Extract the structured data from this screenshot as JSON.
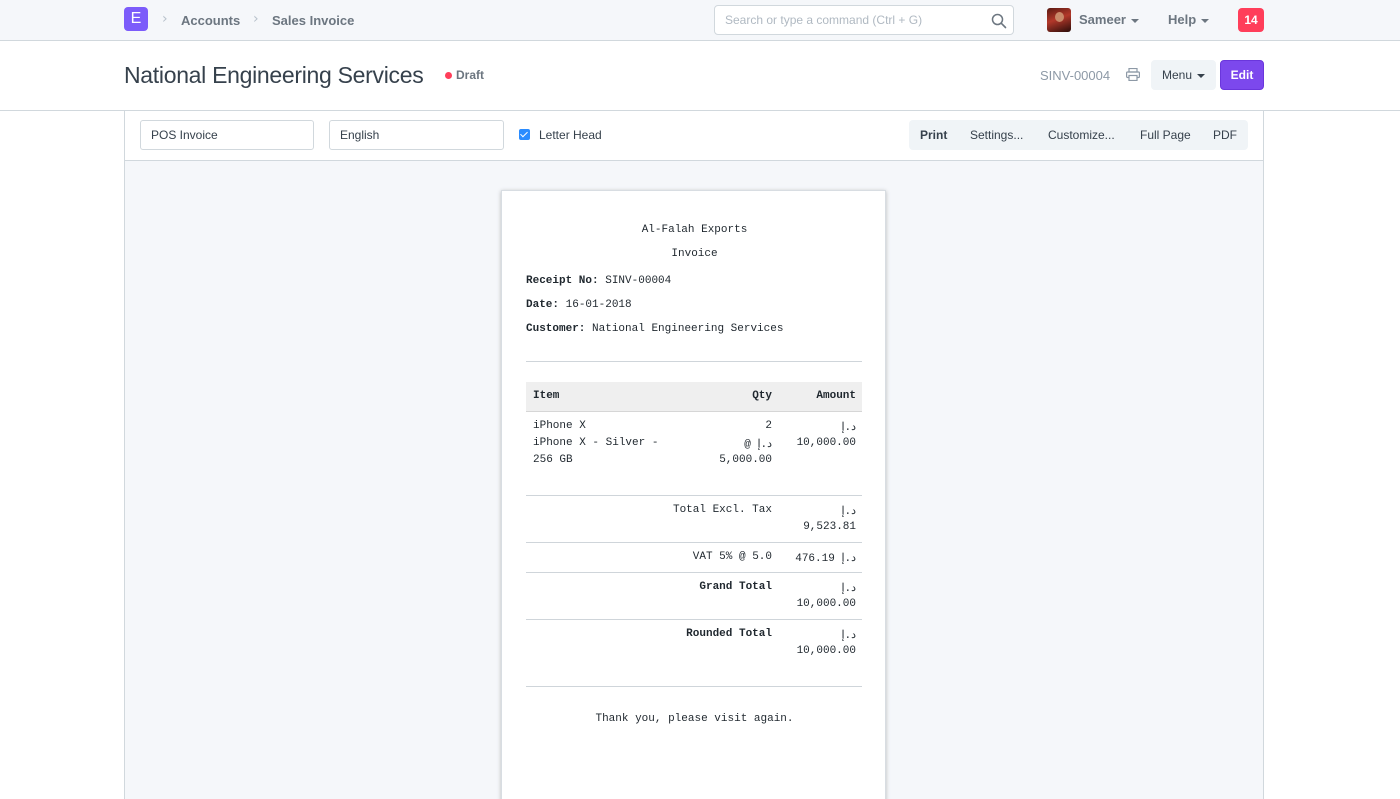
{
  "navbar": {
    "logo_letter": "E",
    "breadcrumbs": [
      "Accounts",
      "Sales Invoice"
    ],
    "search_placeholder": "Search or type a command (Ctrl + G)",
    "user_name": "Sameer",
    "help_label": "Help",
    "notification_count": "14"
  },
  "page_head": {
    "title": "National Engineering Services",
    "status": "Draft",
    "doc_name": "SINV-00004",
    "menu_label": "Menu",
    "edit_label": "Edit"
  },
  "toolbar": {
    "print_format": "POS Invoice",
    "language": "English",
    "letter_head_label": "Letter Head",
    "letter_head_checked": true,
    "buttons": [
      "Print",
      "Settings...",
      "Customize...",
      "Full Page",
      "PDF"
    ]
  },
  "receipt": {
    "company": "Al-Falah Exports",
    "doc_title": "Invoice",
    "receipt_no_label": "Receipt No:",
    "receipt_no": "SINV-00004",
    "date_label": "Date:",
    "date": "16-01-2018",
    "customer_label": "Customer:",
    "customer": "National Engineering Services",
    "columns": [
      "Item",
      "Qty",
      "Amount"
    ],
    "item": {
      "lines": [
        "iPhone X",
        "iPhone X - Silver -",
        "256 GB"
      ],
      "qty": "2",
      "rate_lines": [
        "@ د.إ",
        "5,000.00"
      ],
      "amount_lines": [
        "د.إ",
        "10,000.00"
      ]
    },
    "totals": [
      {
        "label": "Total Excl. Tax",
        "currency": "د.إ",
        "value": "9,523.81"
      },
      {
        "label": "VAT 5% @ 5.0",
        "value_inline": "476.19 د.إ"
      },
      {
        "label": "Grand Total",
        "currency": "د.إ",
        "value": "10,000.00"
      },
      {
        "label": "Rounded Total",
        "currency": "د.إ",
        "value": "10,000.00"
      }
    ],
    "footer": "Thank you, please visit again."
  },
  "colors": {
    "brand": "#7c5cfa",
    "edit_button": "#7c48ed",
    "notification": "#ff3e5a",
    "checkbox": "#2a8cff"
  }
}
